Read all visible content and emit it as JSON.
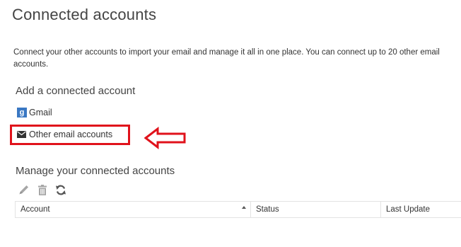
{
  "page": {
    "title": "Connected accounts",
    "description": "Connect your other accounts to import your email and manage it all in one place. You can connect up to 20 other email accounts."
  },
  "add_section": {
    "heading": "Add a connected account",
    "providers": [
      {
        "label": "Gmail",
        "icon": "google-g-icon",
        "icon_glyph": "g"
      },
      {
        "label": "Other email accounts",
        "icon": "envelope-icon"
      }
    ]
  },
  "annotation": {
    "highlight_color": "#e0121b",
    "arrow_icon": "left-arrow-icon"
  },
  "manage_section": {
    "heading": "Manage your connected accounts",
    "toolbar": [
      {
        "name": "edit",
        "icon": "pencil-icon"
      },
      {
        "name": "delete",
        "icon": "trash-icon"
      },
      {
        "name": "refresh",
        "icon": "refresh-icon"
      }
    ],
    "table": {
      "columns": [
        "Account",
        "Status",
        "Last Update"
      ],
      "sorted_column": "Account",
      "sort_direction": "ascending",
      "rows": []
    }
  },
  "colors": {
    "text": "#333333",
    "icon_gray": "#a6a6a6",
    "google_blue": "#3a78c3",
    "border": "#e3e3e3"
  }
}
